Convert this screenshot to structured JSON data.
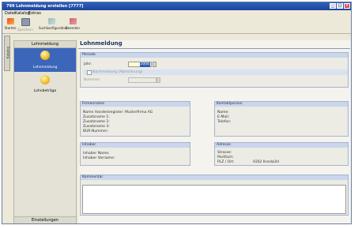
{
  "window": {
    "title": "799 Lohnmeldung erstellen [7777]",
    "controls": [
      "_",
      "□",
      "×"
    ]
  },
  "menu": [
    "Datei",
    "Katalog",
    "Extras"
  ],
  "toolbar": [
    {
      "label": "Starten",
      "icon": "start-icon"
    },
    {
      "label": "Speichern",
      "icon": "save-icon"
    },
    {
      "label": "Suchkonfiguration",
      "icon": "search-config-icon"
    },
    {
      "label": "Beenden",
      "icon": "exit-icon"
    }
  ],
  "left_tab": "Katalog",
  "sidebar": {
    "header": "Lohnmeldung",
    "items": [
      {
        "label": "Lohnmeldung",
        "active": true,
        "icon": "coin-icon"
      },
      {
        "label": "Lohnbeträge",
        "active": false,
        "icon": "coin-icon"
      }
    ],
    "footer": "Einstellungen"
  },
  "main": {
    "title": "Lohnmeldung",
    "periode": {
      "header": "Periode",
      "jahr_label": "Jahr:",
      "jahr_value": "2006",
      "checkbox_label": "Nachmeldung (Abrechnung)",
      "nummer_label": "Nummer:"
    },
    "firmenname": {
      "header": "Firmenname",
      "lines": [
        "Name Handelsregister: Musterfirma AG",
        "Zusatzname 1:",
        "Zusatzname 2:",
        "Zusatzname 3:",
        "BUR-Nummer:"
      ]
    },
    "kontaktperson": {
      "header": "Kontaktperson",
      "lines": [
        "Name:",
        "E-Mail:",
        "Telefon:"
      ]
    },
    "inhaber": {
      "header": "Inhaber",
      "lines": [
        "Inhaber Name:",
        "Inhaber Vorname:"
      ]
    },
    "adresse": {
      "header": "Adresse",
      "lines": [
        "Strasse:",
        "Postfach:",
        "PLZ / Ort:"
      ],
      "ort_value": "9302 Kronbühl"
    },
    "kommentar": {
      "header": "Kommentar"
    }
  },
  "colors": {
    "titlebar": "#2f5fb8",
    "active_item": "#3b66b9",
    "section_header": "#c9d6ec",
    "title_text": "#1c2f5c"
  }
}
